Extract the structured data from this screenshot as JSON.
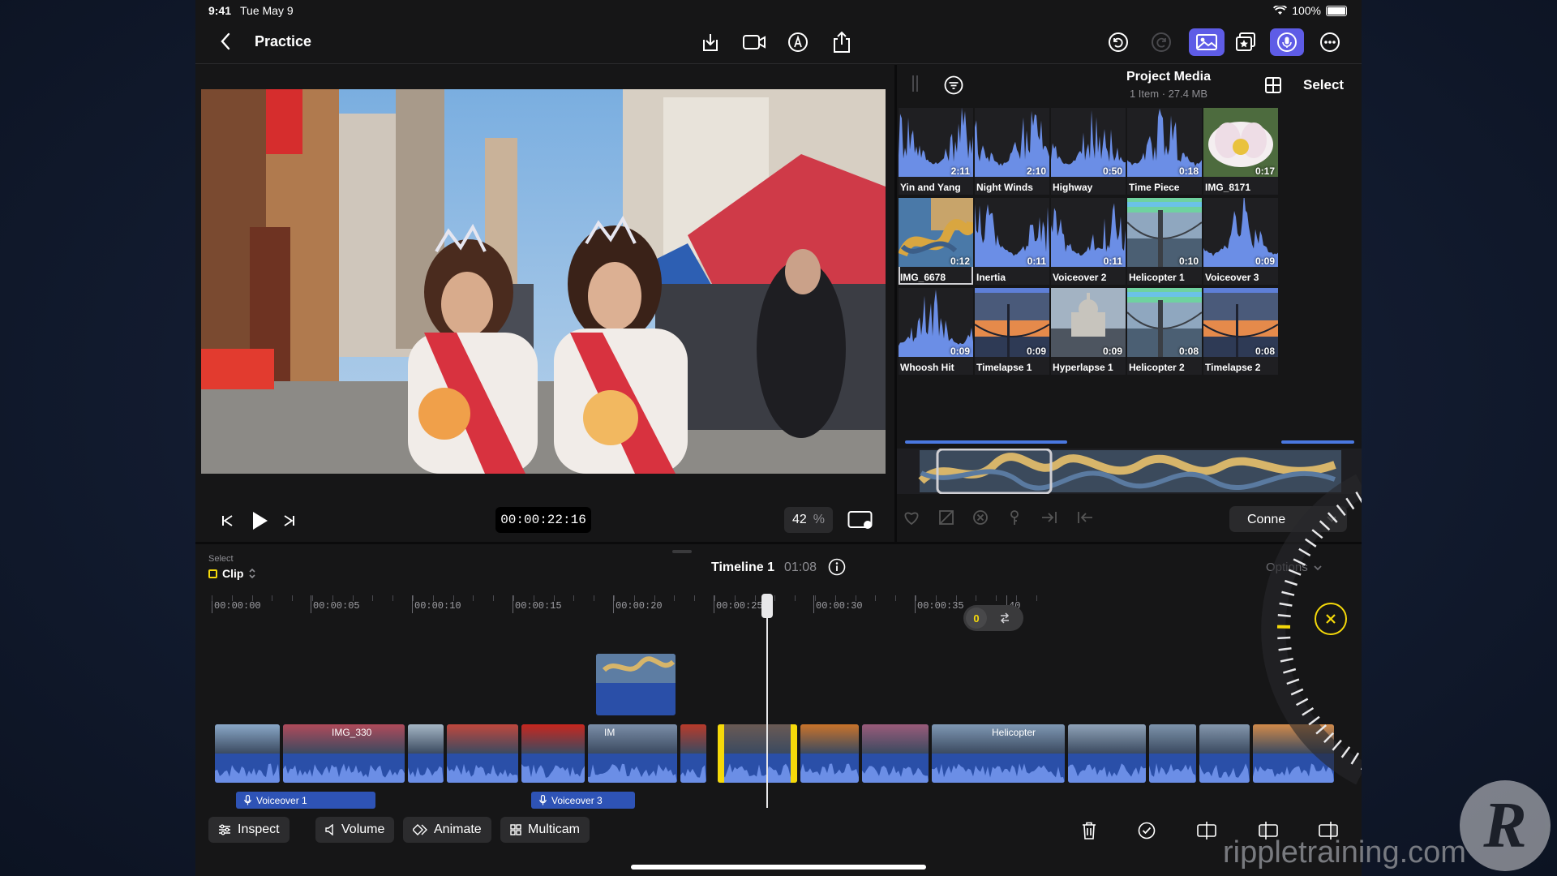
{
  "status": {
    "time": "9:41",
    "date": "Tue May 9",
    "battery": "100%"
  },
  "header": {
    "title": "Practice"
  },
  "viewer": {
    "timecode": "00:00:22:16",
    "zoom": "42",
    "zoom_unit": "%"
  },
  "browser": {
    "title": "Project Media",
    "meta": "1 Item  ·  27.4 MB",
    "select_label": "Select",
    "connect_label": "Conne",
    "items": [
      {
        "name": "Yin and Yang",
        "duration": "2:11",
        "kind": "audio"
      },
      {
        "name": "Night Winds",
        "duration": "2:10",
        "kind": "audio"
      },
      {
        "name": "Highway",
        "duration": "0:50",
        "kind": "audio"
      },
      {
        "name": "Time Piece",
        "duration": "0:18",
        "kind": "audio"
      },
      {
        "name": "IMG_8171",
        "duration": "0:17",
        "kind": "flower"
      },
      {
        "name": "IMG_6678",
        "duration": "0:12",
        "kind": "dragon"
      },
      {
        "name": "Inertia",
        "duration": "0:11",
        "kind": "audio"
      },
      {
        "name": "Voiceover 2",
        "duration": "0:11",
        "kind": "audio"
      },
      {
        "name": "Helicopter 1",
        "duration": "0:10",
        "kind": "bridge"
      },
      {
        "name": "Voiceover 3",
        "duration": "0:09",
        "kind": "audio"
      },
      {
        "name": "Whoosh Hit",
        "duration": "0:09",
        "kind": "audio"
      },
      {
        "name": "Timelapse 1",
        "duration": "0:09",
        "kind": "sunset"
      },
      {
        "name": "Hyperlapse 1",
        "duration": "0:09",
        "kind": "cityhall"
      },
      {
        "name": "Helicopter 2",
        "duration": "0:08",
        "kind": "bridge"
      },
      {
        "name": "Timelapse 2",
        "duration": "0:08",
        "kind": "sunset"
      }
    ]
  },
  "timeline": {
    "select_label": "Select",
    "mode": "Clip",
    "name": "Timeline 1",
    "duration": "01:08",
    "options_label": "Options",
    "ruler": [
      "00:00:00",
      "00:00:05",
      "00:00:10",
      "00:00:15",
      "00:00:20",
      "00:00:25",
      "00:00:30",
      "00:00:35",
      "40"
    ],
    "toggle_value": "0",
    "clip_labels": {
      "img330": "IMG_330",
      "im": "IM",
      "helicopter": "Helicopter"
    },
    "voiceovers": [
      "Voiceover 1",
      "Voiceover 3"
    ]
  },
  "bottom": {
    "inspect": "Inspect",
    "volume": "Volume",
    "animate": "Animate",
    "multicam": "Multicam"
  },
  "watermark": "rippletraining.com",
  "colors": {
    "accent": "#5e5ce6",
    "selection": "#f5d90a",
    "clip": "#2a4fa8",
    "audio": "#4a78e0"
  }
}
